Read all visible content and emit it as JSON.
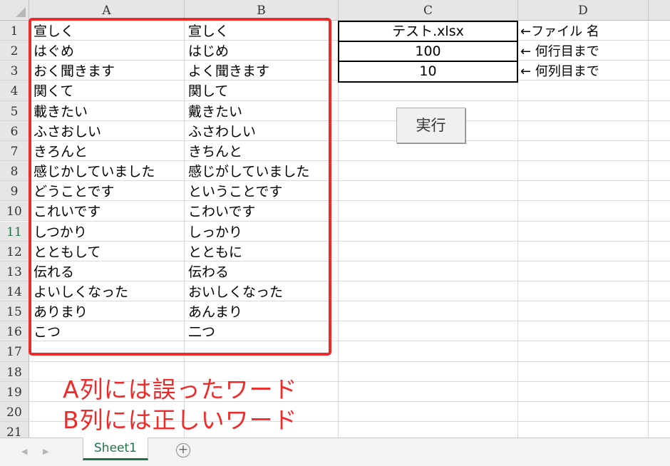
{
  "sheet": {
    "columns": [
      "A",
      "B",
      "C",
      "D"
    ],
    "rows": [
      "1",
      "2",
      "3",
      "4",
      "5",
      "6",
      "7",
      "8",
      "9",
      "10",
      "11",
      "12",
      "13",
      "14",
      "15",
      "16",
      "17",
      "18",
      "19",
      "20",
      "21"
    ],
    "active_row": "11",
    "col_a": [
      "宣しく",
      "はぐめ",
      "おく聞きます",
      "関くて",
      "載きたい",
      "ふさおしい",
      "きろんと",
      "感じかしていました",
      "どうことです",
      "これいです",
      "しつかり",
      "とともして",
      "伝れる",
      "よいしくなった",
      "ありまり",
      "こつ"
    ],
    "col_b": [
      "宣しく",
      "はじめ",
      "よく聞きます",
      "関して",
      "戴きたい",
      "ふさわしい",
      "きちんと",
      "感じがしていました",
      "ということです",
      "こわいです",
      "しっかり",
      "とともに",
      "伝わる",
      "おいしくなった",
      "あんまり",
      "二つ"
    ],
    "file_name": "テスト.xlsx",
    "row_count": "100",
    "col_count": "10",
    "note_file": "←ファイル 名",
    "note_rows": "← 何行目まで",
    "note_cols": "← 何列目まで",
    "run_button": "実行",
    "annotation_line1": "A列には誤ったワード",
    "annotation_line2": "B列には正しいワード"
  },
  "tabs": {
    "sheet_tab": "Sheet1",
    "add_icon": "plus-icon",
    "prev_icon": "triangle-left-icon",
    "next_icon": "triangle-right-icon"
  },
  "colors": {
    "accent": "#217346",
    "annotation": "#ee2b2b"
  }
}
